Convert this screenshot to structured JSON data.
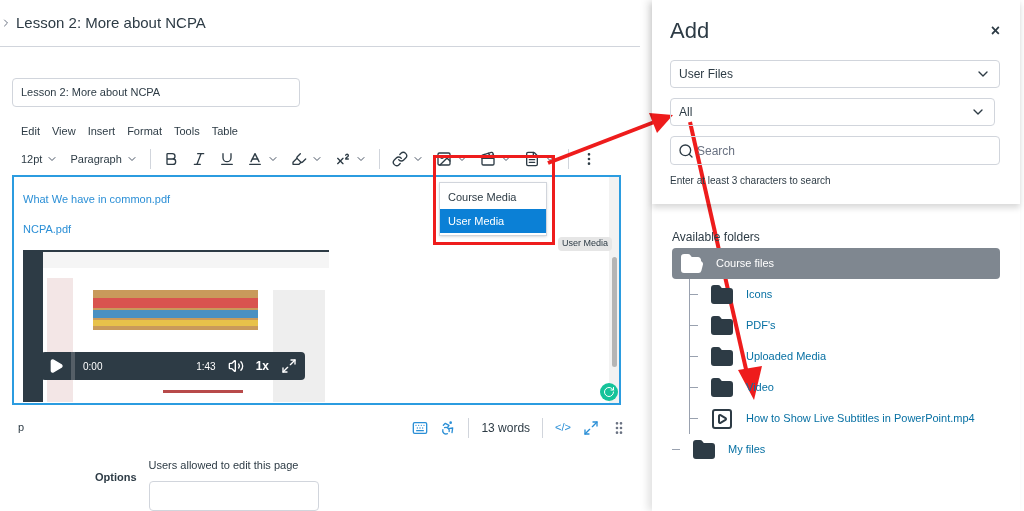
{
  "header": {
    "title": "Lesson 2: More about NCPA"
  },
  "title_field": {
    "value": "Lesson 2: More about NCPA"
  },
  "menubar": [
    "Edit",
    "View",
    "Insert",
    "Format",
    "Tools",
    "Table"
  ],
  "toolbar": {
    "font_size": "12pt",
    "block_format": "Paragraph"
  },
  "media_menu": {
    "items": [
      {
        "label": "Course Media",
        "selected": false
      },
      {
        "label": "User Media",
        "selected": true
      }
    ],
    "tooltip": "User Media"
  },
  "content": {
    "links": [
      "What We have in common.pdf",
      "NCPA.pdf"
    ],
    "video": {
      "current_time": "0:00",
      "duration": "1:43",
      "speed": "1x"
    }
  },
  "status_bar": {
    "path": "p",
    "word_count": "13 words",
    "html_toggle": "</>"
  },
  "options": {
    "label": "Options",
    "field_label": "Users allowed to edit this page"
  },
  "panel": {
    "title": "Add",
    "close": "×",
    "source": "User Files",
    "filter": "All",
    "search_placeholder": "Search",
    "hint": "Enter at least 3 characters to search",
    "folders_heading": "Available folders",
    "tree": [
      {
        "label": "Course files",
        "kind": "folder",
        "selected": true,
        "expanded": true,
        "children": [
          {
            "label": "Icons",
            "kind": "folder",
            "selected": false,
            "expanded": false
          },
          {
            "label": "PDF's",
            "kind": "folder",
            "selected": false,
            "expanded": false
          },
          {
            "label": "Uploaded Media",
            "kind": "folder",
            "selected": false,
            "expanded": false
          },
          {
            "label": "Video",
            "kind": "folder",
            "selected": false,
            "expanded": false
          },
          {
            "label": "How to Show Live Subtitles in PowerPoint.mp4",
            "kind": "video",
            "selected": false,
            "expanded": false
          }
        ]
      },
      {
        "label": "My files",
        "kind": "folder",
        "selected": false,
        "expanded": false
      }
    ]
  }
}
